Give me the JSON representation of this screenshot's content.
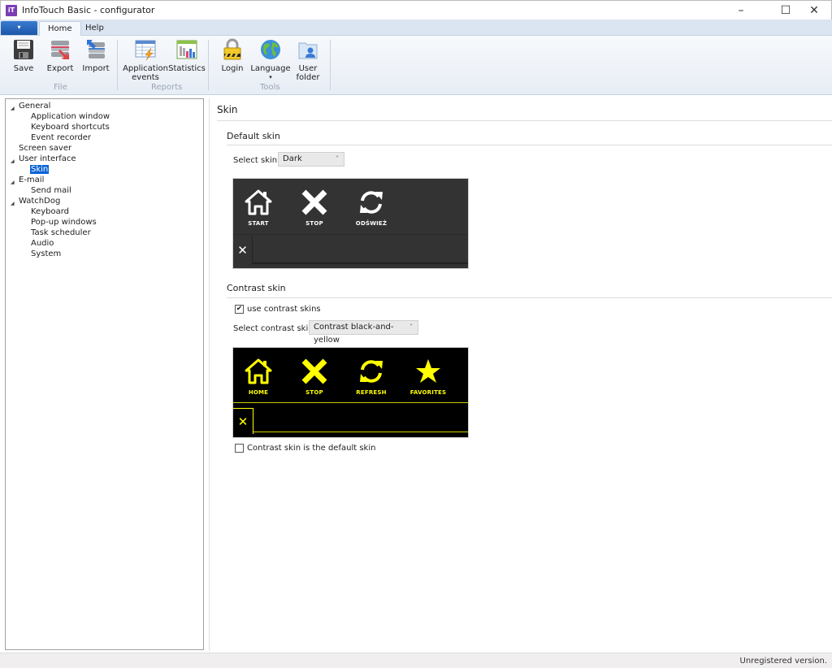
{
  "window": {
    "title": "InfoTouch Basic - configurator",
    "app_icon": "infotouch-logo-icon",
    "controls": {
      "minimize": "–",
      "maximize": "☐",
      "close": "✕"
    }
  },
  "ribbon": {
    "file_menu_glyph": "▾",
    "tabs": [
      {
        "label": "Home",
        "active": true
      },
      {
        "label": "Help",
        "active": false
      }
    ],
    "groups": [
      {
        "label": "File",
        "buttons": [
          {
            "label": "Save",
            "icon": "floppy-disk-icon"
          },
          {
            "label": "Export",
            "icon": "database-export-icon"
          },
          {
            "label": "Import",
            "icon": "database-import-icon"
          }
        ]
      },
      {
        "label": "Reports",
        "buttons": [
          {
            "label": "Application",
            "label2": "events",
            "icon": "table-lightning-icon"
          },
          {
            "label": "Statistics",
            "icon": "bar-chart-icon"
          }
        ]
      },
      {
        "label": "Tools",
        "buttons": [
          {
            "label": "Login",
            "icon": "padlock-icon"
          },
          {
            "label": "Language",
            "label2": "▾",
            "icon": "globe-icon"
          },
          {
            "label": "User",
            "label2": "folder",
            "icon": "user-folder-icon"
          }
        ]
      }
    ]
  },
  "tree": {
    "items": [
      {
        "label": "General",
        "level": 0,
        "expanded": true
      },
      {
        "label": "Application window",
        "level": 1
      },
      {
        "label": "Keyboard shortcuts",
        "level": 1
      },
      {
        "label": "Event recorder",
        "level": 1
      },
      {
        "label": "Screen saver",
        "level": 0
      },
      {
        "label": "User interface",
        "level": 0,
        "expanded": true
      },
      {
        "label": "Skin",
        "level": 1,
        "selected": true
      },
      {
        "label": "E-mail",
        "level": 0,
        "expanded": true
      },
      {
        "label": "Send mail",
        "level": 1
      },
      {
        "label": "WatchDog",
        "level": 0,
        "expanded": true
      },
      {
        "label": "Keyboard",
        "level": 1
      },
      {
        "label": "Pop-up windows",
        "level": 1
      },
      {
        "label": "Task scheduler",
        "level": 1
      },
      {
        "label": "Audio",
        "level": 1
      },
      {
        "label": "System",
        "level": 1
      }
    ],
    "expand_glyph": "◢"
  },
  "page": {
    "title": "Skin",
    "default_skin": {
      "heading": "Default skin",
      "select_label": "Select skin:",
      "selected": "Dark",
      "preview": {
        "background": "#333333",
        "accent": "#ffffff",
        "buttons": [
          {
            "label": "START",
            "icon": "home-icon"
          },
          {
            "label": "STOP",
            "icon": "stop-x-icon"
          },
          {
            "label": "ODŚWIEŻ",
            "icon": "refresh-icon"
          }
        ],
        "close_glyph": "✕"
      }
    },
    "contrast_skin": {
      "heading": "Contrast skin",
      "use_label": "use contrast skins",
      "use_checked": true,
      "select_label": "Select contrast skin:",
      "selected": "Contrast black-and-yellow",
      "preview": {
        "background": "#000000",
        "accent": "#ffff00",
        "buttons": [
          {
            "label": "HOME",
            "icon": "home-icon"
          },
          {
            "label": "STOP",
            "icon": "stop-x-icon"
          },
          {
            "label": "REFRESH",
            "icon": "refresh-icon"
          },
          {
            "label": "FAVORITES",
            "icon": "star-icon"
          }
        ],
        "close_glyph": "✕"
      },
      "default_label": "Contrast skin is the default skin",
      "default_checked": false
    },
    "check_glyph": "✔",
    "chevron_glyph": "˅"
  },
  "status": {
    "text": "Unregistered version."
  }
}
